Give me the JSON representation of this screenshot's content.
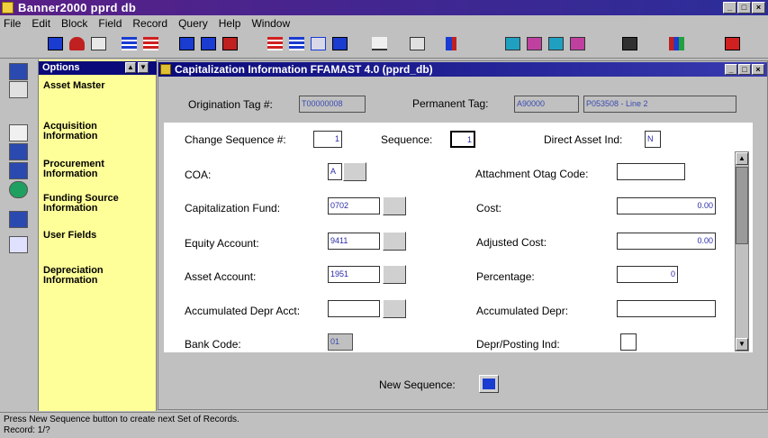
{
  "window": {
    "title": "Banner2000   pprd  db"
  },
  "menu": [
    "File",
    "Edit",
    "Block",
    "Field",
    "Record",
    "Query",
    "Help",
    "Window"
  ],
  "toolbar": {
    "icons": [
      "save-icon",
      "rollback-icon",
      "print-icon",
      "previous-block-icon",
      "next-block-icon",
      "enter-query-icon",
      "execute-query-icon",
      "cancel-query-icon",
      "insert-record-icon",
      "remove-record-icon",
      "duplicate-icon",
      "clear-icon",
      "edit-icon",
      "print-screen-icon",
      "chart-icon",
      "help-icon",
      "item-help-icon",
      "list-values-icon",
      "count-icon",
      "calculator-icon",
      "books-icon",
      "exit-icon"
    ]
  },
  "options": {
    "header": "Options",
    "items": [
      "Asset Master",
      "Acquisition Information",
      "Procurement Information",
      "Funding Source Information",
      "User Fields",
      "Depreciation Information"
    ]
  },
  "form": {
    "title": "Capitalization Information  FFAMAST 4.0  (pprd_db)",
    "origination_tag_label": "Origination Tag #:",
    "origination_tag_value": "T00000008",
    "permanent_tag_label": "Permanent Tag:",
    "permanent_tag_value": "A90000",
    "permanent_tag_desc": "P053508 - Line 2",
    "change_seq_label": "Change Sequence #:",
    "change_seq_value": "1",
    "sequence_label": "Sequence:",
    "sequence_value": "1",
    "direct_asset_label": "Direct Asset Ind:",
    "direct_asset_value": "N",
    "coa_label": "COA:",
    "coa_value": "A",
    "attachment_otag_label": "Attachment Otag Code:",
    "attachment_otag_value": "",
    "cap_fund_label": "Capitalization Fund:",
    "cap_fund_value": "0702",
    "cost_label": "Cost:",
    "cost_value": "0.00",
    "equity_label": "Equity Account:",
    "equity_value": "9411",
    "adjusted_cost_label": "Adjusted Cost:",
    "adjusted_cost_value": "0.00",
    "asset_account_label": "Asset Account:",
    "asset_account_value": "1951",
    "percentage_label": "Percentage:",
    "percentage_value": "0",
    "accum_depr_acct_label": "Accumulated Depr Acct:",
    "accum_depr_acct_value": "",
    "accum_depr_label": "Accumulated Depr:",
    "accum_depr_value": "",
    "bank_code_label": "Bank Code:",
    "bank_code_value": "01",
    "depr_posting_label": "Depr/Posting Ind:",
    "depr_posting_value": "",
    "new_sequence_label": "New Sequence:"
  },
  "status": {
    "line1": "Press New Sequence button to create next Set of Records.",
    "line2": "Record: 1/?"
  }
}
